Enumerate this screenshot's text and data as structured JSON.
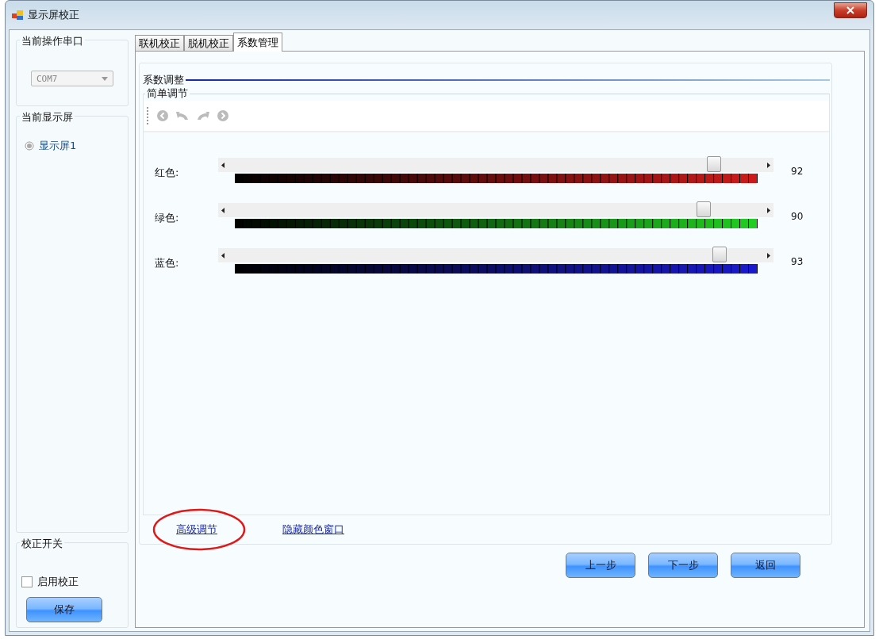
{
  "window": {
    "title": "显示屏校正"
  },
  "sidebar": {
    "port_group": {
      "title": "当前操作串口",
      "port": {
        "value": "COM7",
        "disabled": true
      }
    },
    "screen_group": {
      "title": "当前显示屏",
      "screens": [
        {
          "label": "显示屏1",
          "selected": true
        }
      ]
    },
    "switch_group": {
      "title": "校正开关",
      "enable": {
        "label": "启用校正",
        "checked": false
      },
      "save_button": "保存"
    }
  },
  "tabs": [
    {
      "label": "联机校正",
      "selected": false
    },
    {
      "label": "脱机校正",
      "selected": false
    },
    {
      "label": "系数管理",
      "selected": true
    }
  ],
  "coefficient": {
    "title": "系数调整",
    "simple": {
      "title": "简单调节",
      "toolbar": [
        {
          "kind": "back",
          "disabled": true
        },
        {
          "kind": "undo",
          "disabled": true
        },
        {
          "kind": "redo",
          "disabled": true
        },
        {
          "kind": "forward",
          "disabled": true
        }
      ],
      "channels": [
        {
          "label": "红色:",
          "level": 0.92,
          "reading": "92",
          "color": "#cc1a1a"
        },
        {
          "label": "绿色:",
          "level": 0.9,
          "reading": "90",
          "color": "#22cc22"
        },
        {
          "label": "蓝色:",
          "level": 0.93,
          "reading": "93",
          "color": "#1a1acc"
        }
      ]
    },
    "links": [
      {
        "label": "高级调节",
        "circled": true
      },
      {
        "label": "隐藏颜色窗口",
        "circled": false
      }
    ]
  },
  "buttons": [
    "上一步",
    "下一步",
    "返回"
  ]
}
